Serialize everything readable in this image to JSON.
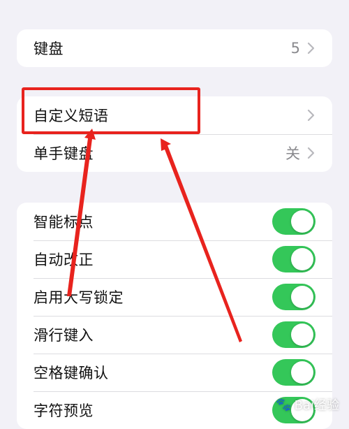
{
  "group1": {
    "keyboards": {
      "label": "键盘",
      "value": "5"
    }
  },
  "group2": {
    "text_replacement": {
      "label": "自定义短语"
    },
    "one_handed": {
      "label": "单手键盘",
      "value": "关"
    }
  },
  "group3": {
    "items": [
      {
        "label": "智能标点",
        "on": true
      },
      {
        "label": "自动改正",
        "on": true
      },
      {
        "label": "启用大写锁定",
        "on": true
      },
      {
        "label": "滑行键入",
        "on": true
      },
      {
        "label": "空格键确认",
        "on": true
      },
      {
        "label": "字符预览",
        "on": true
      }
    ]
  },
  "annotation": {
    "color": "#e8231e"
  },
  "colors": {
    "toggle_on": "#34c759",
    "background": "#f2f1f7"
  },
  "watermark": {
    "text": "Bai经验"
  }
}
